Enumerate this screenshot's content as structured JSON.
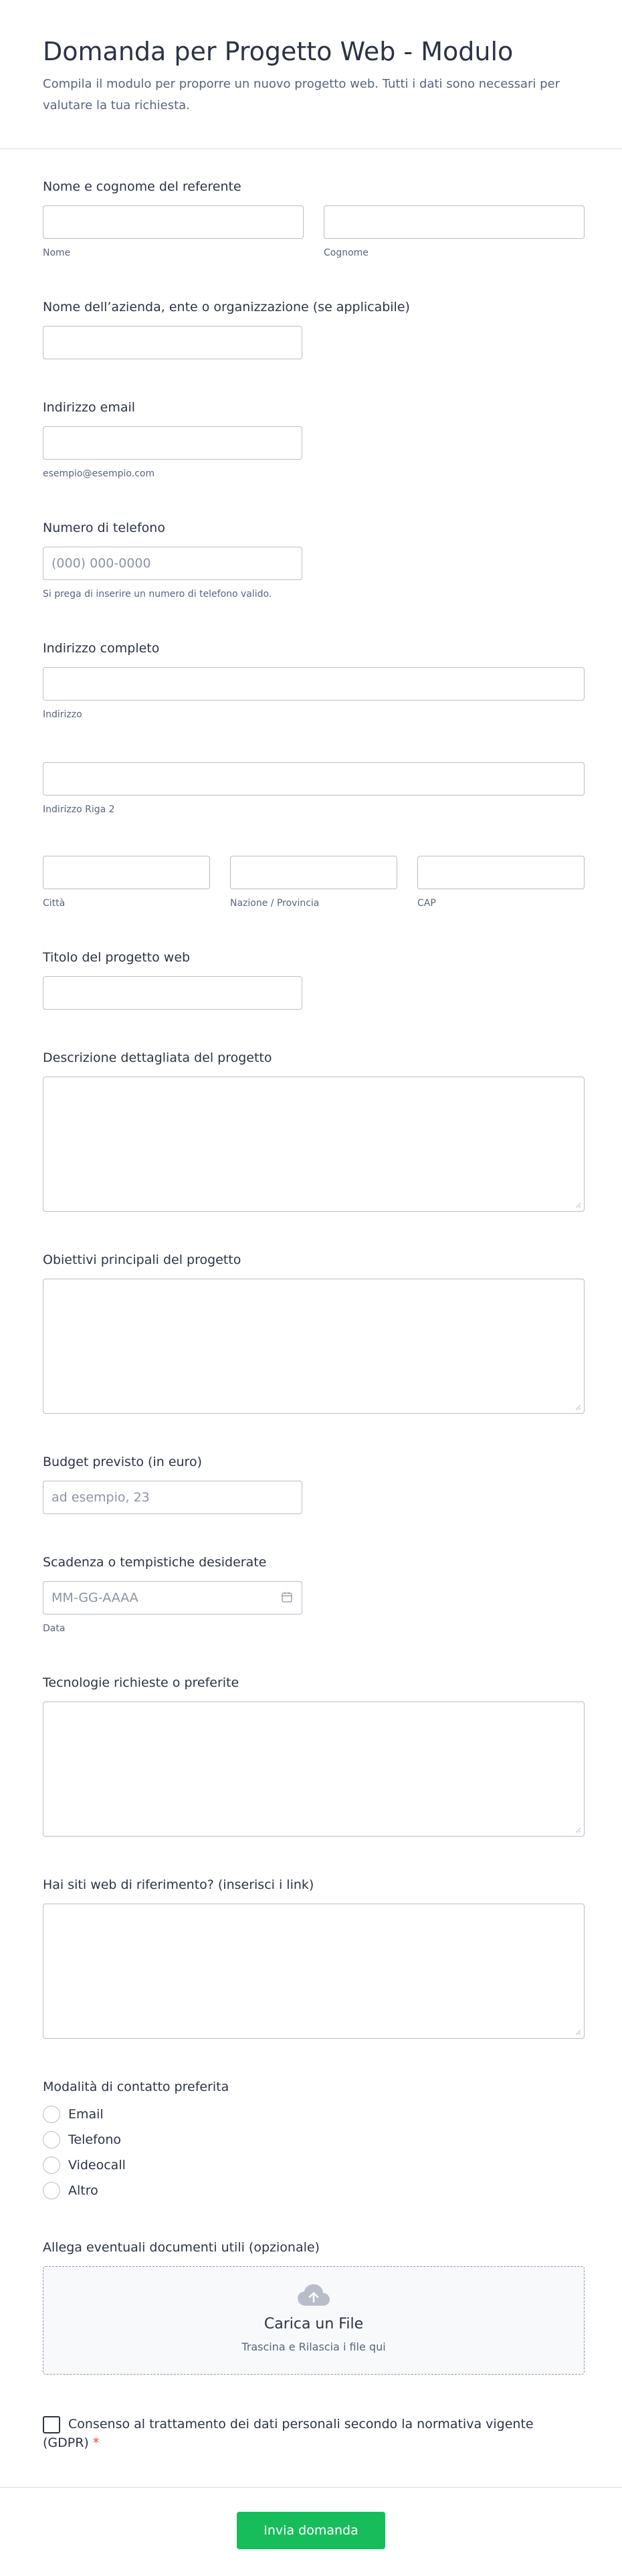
{
  "header": {
    "title": "Domanda per Progetto Web - Modulo",
    "subtitle": "Compila il modulo per proporre un nuovo progetto web. Tutti i dati sono necessari per valutare la tua richiesta."
  },
  "fields": {
    "referente": {
      "label": "Nome e cognome del referente",
      "first_sublabel": "Nome",
      "last_sublabel": "Cognome"
    },
    "azienda": {
      "label": "Nome dell’azienda, ente o organizzazione (se applicabile)"
    },
    "email": {
      "label": "Indirizzo email",
      "sublabel": "esempio@esempio.com"
    },
    "telefono": {
      "label": "Numero di telefono",
      "placeholder": "(000) 000-0000",
      "help": "Si prega di inserire un numero di telefono valido."
    },
    "indirizzo": {
      "label": "Indirizzo completo",
      "line1_sublabel": "Indirizzo",
      "line2_sublabel": "Indirizzo Riga 2",
      "city_sublabel": "Città",
      "state_sublabel": "Nazione / Provincia",
      "zip_sublabel": "CAP"
    },
    "titolo": {
      "label": "Titolo del progetto web"
    },
    "descrizione": {
      "label": "Descrizione dettagliata del progetto"
    },
    "obiettivi": {
      "label": "Obiettivi principali del progetto"
    },
    "budget": {
      "label": "Budget previsto (in euro)",
      "placeholder": "ad esempio, 23"
    },
    "scadenza": {
      "label": "Scadenza o tempistiche desiderate",
      "placeholder": "MM-GG-AAAA",
      "sublabel": "Data"
    },
    "tecnologie": {
      "label": "Tecnologie richieste o preferite"
    },
    "riferimenti": {
      "label": "Hai siti web di riferimento? (inserisci i link)"
    },
    "contatto": {
      "label": "Modalità di contatto preferita",
      "options": [
        "Email",
        "Telefono",
        "Videocall",
        "Altro"
      ]
    },
    "allegati": {
      "label": "Allega eventuali documenti utili (opzionale)",
      "upload_title": "Carica un File",
      "upload_sub": "Trascina e Rilascia i file qui"
    },
    "consenso": {
      "text_line1": "Consenso al trattamento dei dati personali secondo la normativa vigente",
      "text_line2": "(GDPR)",
      "required_mark": "*"
    }
  },
  "footer": {
    "submit_label": "Invia domanda"
  },
  "colors": {
    "text": "#2c3345",
    "muted": "#57647e",
    "border": "#b8bdc9",
    "submit": "#18bd5b",
    "required": "#f23a3c"
  },
  "icons": [
    "calendar-icon",
    "cloud-upload-icon",
    "resize-grip-icon"
  ]
}
